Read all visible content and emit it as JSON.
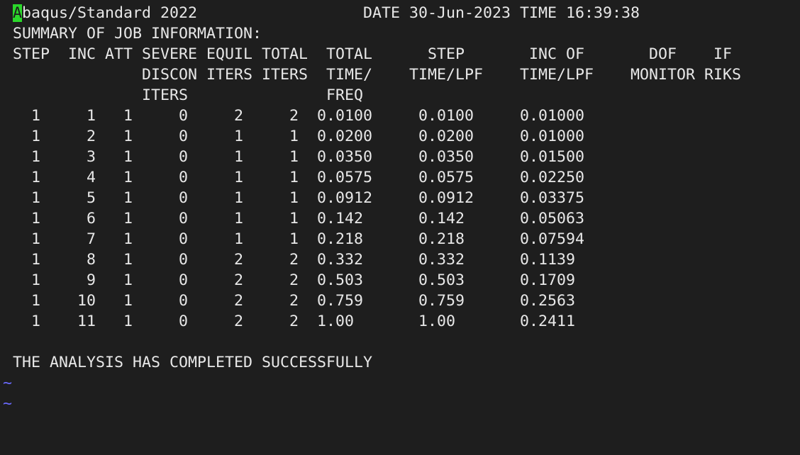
{
  "header": {
    "cursor_char": "A",
    "app_rest": "baqus/Standard 2022",
    "date_time": "DATE 30-Jun-2023 TIME 16:39:38"
  },
  "summary_title": "SUMMARY OF JOB INFORMATION:",
  "columns": {
    "row1": [
      "STEP",
      "INC",
      "ATT",
      "SEVERE",
      "EQUIL",
      "TOTAL",
      "TOTAL",
      "STEP",
      "INC OF",
      "DOF",
      "IF"
    ],
    "row2": [
      "DISCON",
      "ITERS",
      "ITERS",
      "TIME/",
      "TIME/LPF",
      "TIME/LPF",
      "MONITOR",
      "RIKS"
    ],
    "row3": [
      "ITERS",
      "FREQ"
    ]
  },
  "rows": [
    [
      "1",
      "1",
      "1",
      "0",
      "2",
      "2",
      "0.0100",
      "0.0100",
      "0.01000"
    ],
    [
      "1",
      "2",
      "1",
      "0",
      "1",
      "1",
      "0.0200",
      "0.0200",
      "0.01000"
    ],
    [
      "1",
      "3",
      "1",
      "0",
      "1",
      "1",
      "0.0350",
      "0.0350",
      "0.01500"
    ],
    [
      "1",
      "4",
      "1",
      "0",
      "1",
      "1",
      "0.0575",
      "0.0575",
      "0.02250"
    ],
    [
      "1",
      "5",
      "1",
      "0",
      "1",
      "1",
      "0.0912",
      "0.0912",
      "0.03375"
    ],
    [
      "1",
      "6",
      "1",
      "0",
      "1",
      "1",
      "0.142",
      "0.142",
      "0.05063"
    ],
    [
      "1",
      "7",
      "1",
      "0",
      "1",
      "1",
      "0.218",
      "0.218",
      "0.07594"
    ],
    [
      "1",
      "8",
      "1",
      "0",
      "2",
      "2",
      "0.332",
      "0.332",
      "0.1139"
    ],
    [
      "1",
      "9",
      "1",
      "0",
      "2",
      "2",
      "0.503",
      "0.503",
      "0.1709"
    ],
    [
      "1",
      "10",
      "1",
      "0",
      "2",
      "2",
      "0.759",
      "0.759",
      "0.2563"
    ],
    [
      "1",
      "11",
      "1",
      "0",
      "2",
      "2",
      "1.00",
      "1.00",
      "0.2411"
    ]
  ],
  "footer": "THE ANALYSIS HAS COMPLETED SUCCESSFULLY",
  "empty_line_marker": "~"
}
